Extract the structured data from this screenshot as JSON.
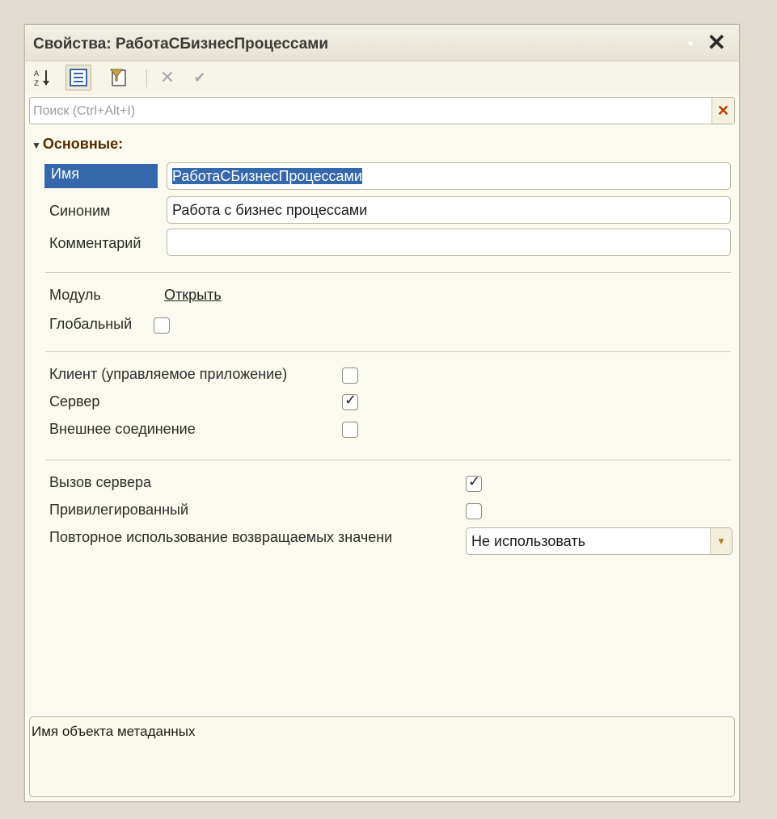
{
  "window": {
    "title": "Свойства: РаботаСБизнесПроцессами",
    "close_label": "✕"
  },
  "toolbar": {
    "sort_icon": "sort-az-icon",
    "categories_icon": "categories-icon",
    "filter_icon": "filter-icon",
    "delete_icon": "delete-icon",
    "apply_icon": "check-icon"
  },
  "search": {
    "placeholder": "Поиск (Ctrl+Alt+I)",
    "value": ""
  },
  "groups": {
    "main": "Основные:"
  },
  "props": {
    "name": {
      "label": "Имя",
      "value": "РаботаСБизнесПроцессами"
    },
    "synonym": {
      "label": "Синоним",
      "value": "Работа с бизнес процессами"
    },
    "comment": {
      "label": "Комментарий",
      "value": ""
    },
    "module": {
      "label": "Модуль",
      "link": "Открыть"
    },
    "global": {
      "label": "Глобальный",
      "checked": false
    },
    "client": {
      "label": "Клиент (управляемое приложение)",
      "checked": false
    },
    "server": {
      "label": "Сервер",
      "checked": true
    },
    "external": {
      "label": "Внешнее соединение",
      "checked": false
    },
    "server_call": {
      "label": "Вызов сервера",
      "checked": true
    },
    "privileged": {
      "label": "Привилегированный",
      "checked": false
    },
    "reuse": {
      "label": "Повторное использование возвращаемых значени",
      "value": "Не использовать"
    }
  },
  "description": "Имя объекта метаданных"
}
